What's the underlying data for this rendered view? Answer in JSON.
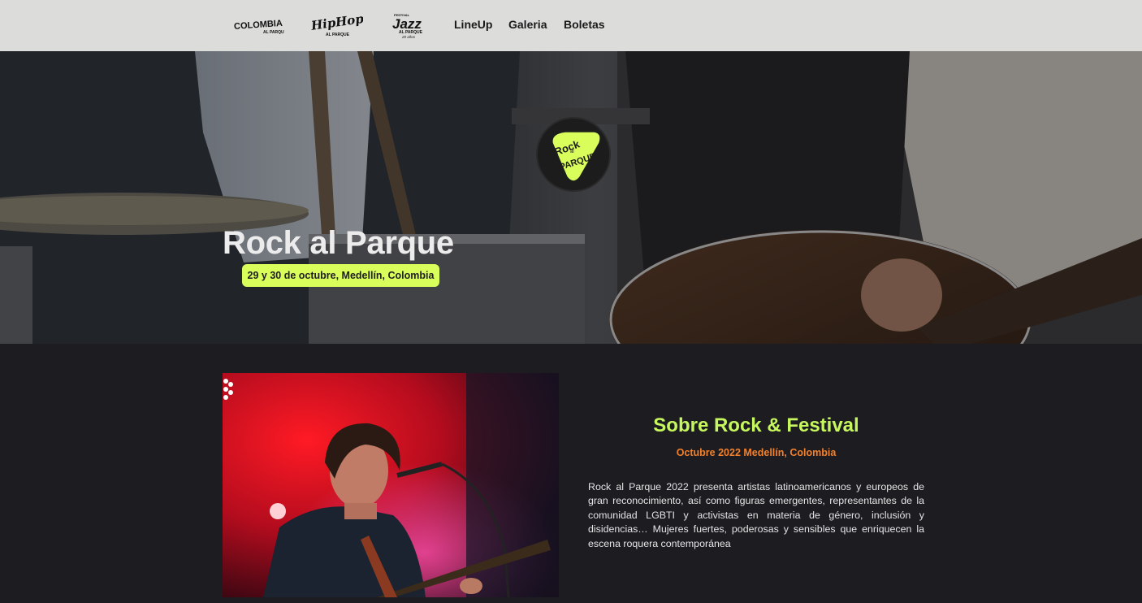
{
  "nav": {
    "logos": [
      {
        "name": "colombia-logo",
        "text": "COLOMBIA"
      },
      {
        "name": "hiphop-logo",
        "text": "HIP HOP"
      },
      {
        "name": "jazz-logo",
        "text": "JAZZ"
      }
    ],
    "links": [
      "LineUp",
      "Galeria",
      "Boletas"
    ]
  },
  "hero": {
    "logo_text": "Rock al Parque",
    "title": "Rock al Parque",
    "date": "29 y 30 de octubre, Medellín, Colombia"
  },
  "about": {
    "heading": "Sobre Rock & Festival",
    "subheading": "Octubre 2022 Medellín, Colombia",
    "body": "Rock al Parque 2022 presenta artistas latinoamericanos y europeos de gran reconocimiento, así como figuras emergentes, representantes de la comunidad LGBTI y activistas en materia de género, inclusión y disidencias… Mujeres fuertes, poderosas y sensibles que enriquecen la escena roquera contemporánea"
  },
  "colors": {
    "navbar_bg": "#dcdcda",
    "accent_lime": "#d9fd5b",
    "heading_lime": "#c7f75e",
    "sub_orange": "#f2802b",
    "page_bg": "#1d1c21"
  }
}
